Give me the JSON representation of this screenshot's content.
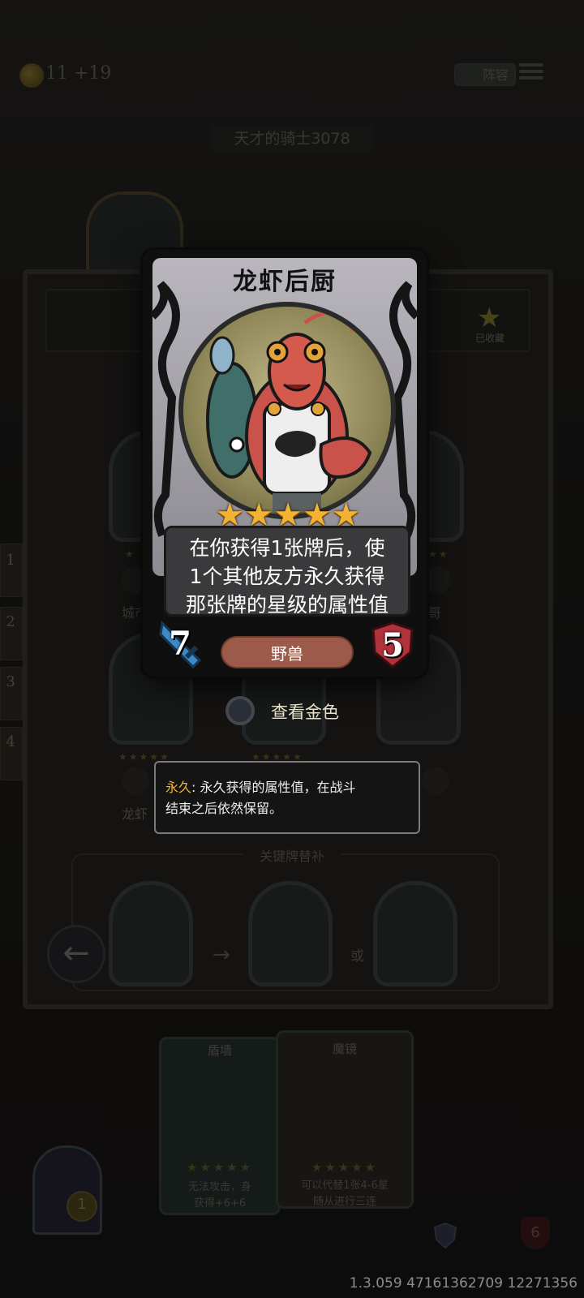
{
  "hud": {
    "gold": "11 +19",
    "lineup_label": "阵容",
    "player_name": "天才的骑士3078"
  },
  "collection": {
    "favorited_label": "已收藏",
    "left_card_name": "城市",
    "right_card_name": "哥",
    "bottom_card_name": "龙虾",
    "side_numbers": [
      "1",
      "2",
      "3",
      "4"
    ],
    "key_card_section_title": "关键牌替补",
    "or_label": "或"
  },
  "card": {
    "name": "龙虾后厨",
    "stars": "★★★★★",
    "description_lines": [
      "在你获得1张牌后，使",
      "1个其他友方永久获得",
      "那张牌的星级的属性值"
    ],
    "attack": "7",
    "health": "5",
    "tribe": "野兽"
  },
  "gold_toggle_label": "查看金色",
  "tooltip": {
    "keyword": "永久",
    "text": ": 永久获得的属性值，在战斗",
    "text_line2": "结束之后依然保留。"
  },
  "bottom_cards": [
    {
      "title": "盾墙",
      "desc1": "无法攻击，身",
      "desc2": "获得+6+6"
    },
    {
      "title": "魔镜",
      "desc1": "可以代替1张4-6星",
      "desc2": "随从进行三连"
    }
  ],
  "hero": {
    "coin": "1"
  },
  "lives": "6",
  "version": "1.3.059 47161362709 12271356",
  "colors": {
    "star": "#f2b233",
    "tribe_pill": "#9b5a4a",
    "keyword": "#f2b43a"
  }
}
